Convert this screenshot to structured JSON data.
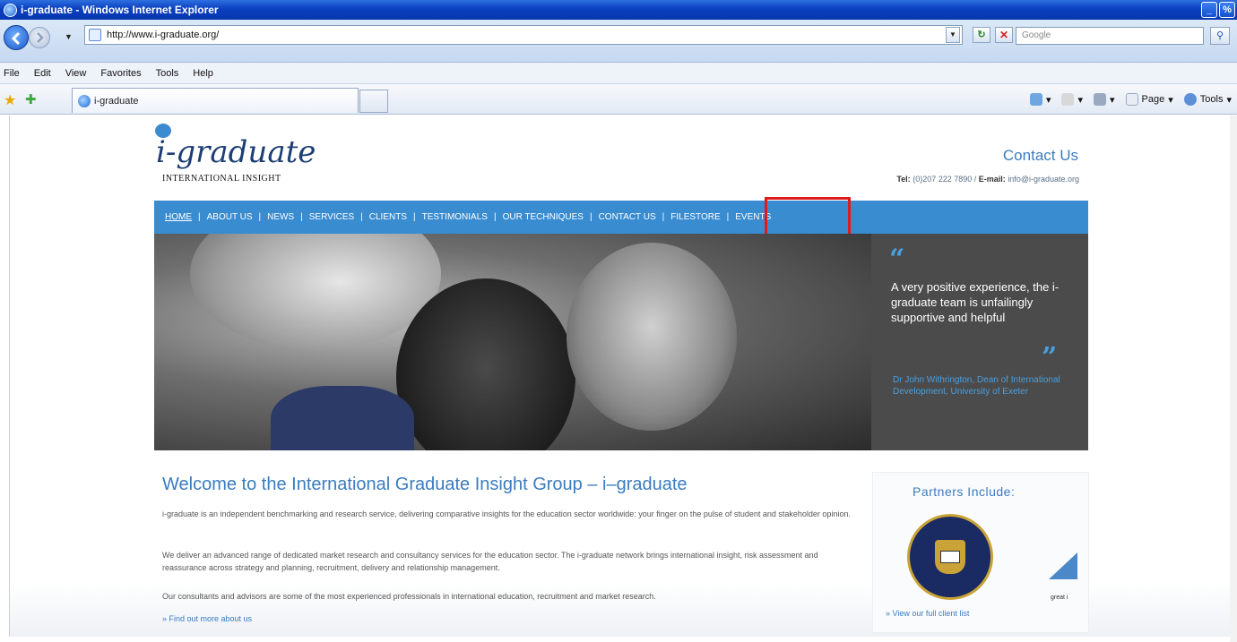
{
  "window": {
    "title": "i-graduate - Windows Internet Explorer",
    "buttons": [
      "_",
      "%",
      "✖"
    ]
  },
  "address": {
    "url": "http://www.i-graduate.org/",
    "search_placeholder": "Google"
  },
  "menubar": [
    "File",
    "Edit",
    "View",
    "Favorites",
    "Tools",
    "Help"
  ],
  "favbar": {
    "tab_label": "i-graduate",
    "commands": [
      "Page",
      "Tools"
    ]
  },
  "site": {
    "logo": "i-graduate",
    "logo_sub": "INTERNATIONAL INSIGHT",
    "contact_title": "Contact Us",
    "contact_tel_label": "Tel:",
    "contact_tel": "(0)207 222 7890",
    "contact_email_label": "E-mail:",
    "contact_email": "info@i-graduate.org",
    "nav": [
      "HOME",
      "ABOUT US",
      "NEWS",
      "SERVICES",
      "CLIENTS",
      "TESTIMONIALS",
      "OUR TECHNIQUES",
      "CONTACT US",
      "FILESTORE",
      "EVENTS"
    ],
    "quote_open": "“",
    "quote_close": "”",
    "quote": "A very positive experience, the i-graduate team is unfailingly supportive and helpful",
    "quote_author": "Dr John Withrington, Dean of International Development, University of Exeter",
    "welcome_title": "Welcome to the International Graduate Insight Group – i–graduate",
    "paragraphs": [
      "i-graduate is an independent benchmarking and research service, delivering comparative insights for the education sector worldwide: your finger on the pulse of student and stakeholder opinion.",
      "We deliver an advanced range of dedicated market research and consultancy services for the education sector. The i-graduate network brings international insight, risk assessment and reassurance across strategy and planning, recruitment, delivery and relationship management.",
      "Our consultants and advisors are some of the most experienced professionals in international education, recruitment and market research."
    ],
    "more_link": "»  Find out more about us",
    "partners_title": "Partners Include:",
    "partner_caption": "great i",
    "client_link": "»  View our full client list"
  },
  "colors": {
    "brand_blue": "#3a8cd1",
    "link_blue": "#3a7cc0",
    "highlight_red": "#e01a1a"
  }
}
